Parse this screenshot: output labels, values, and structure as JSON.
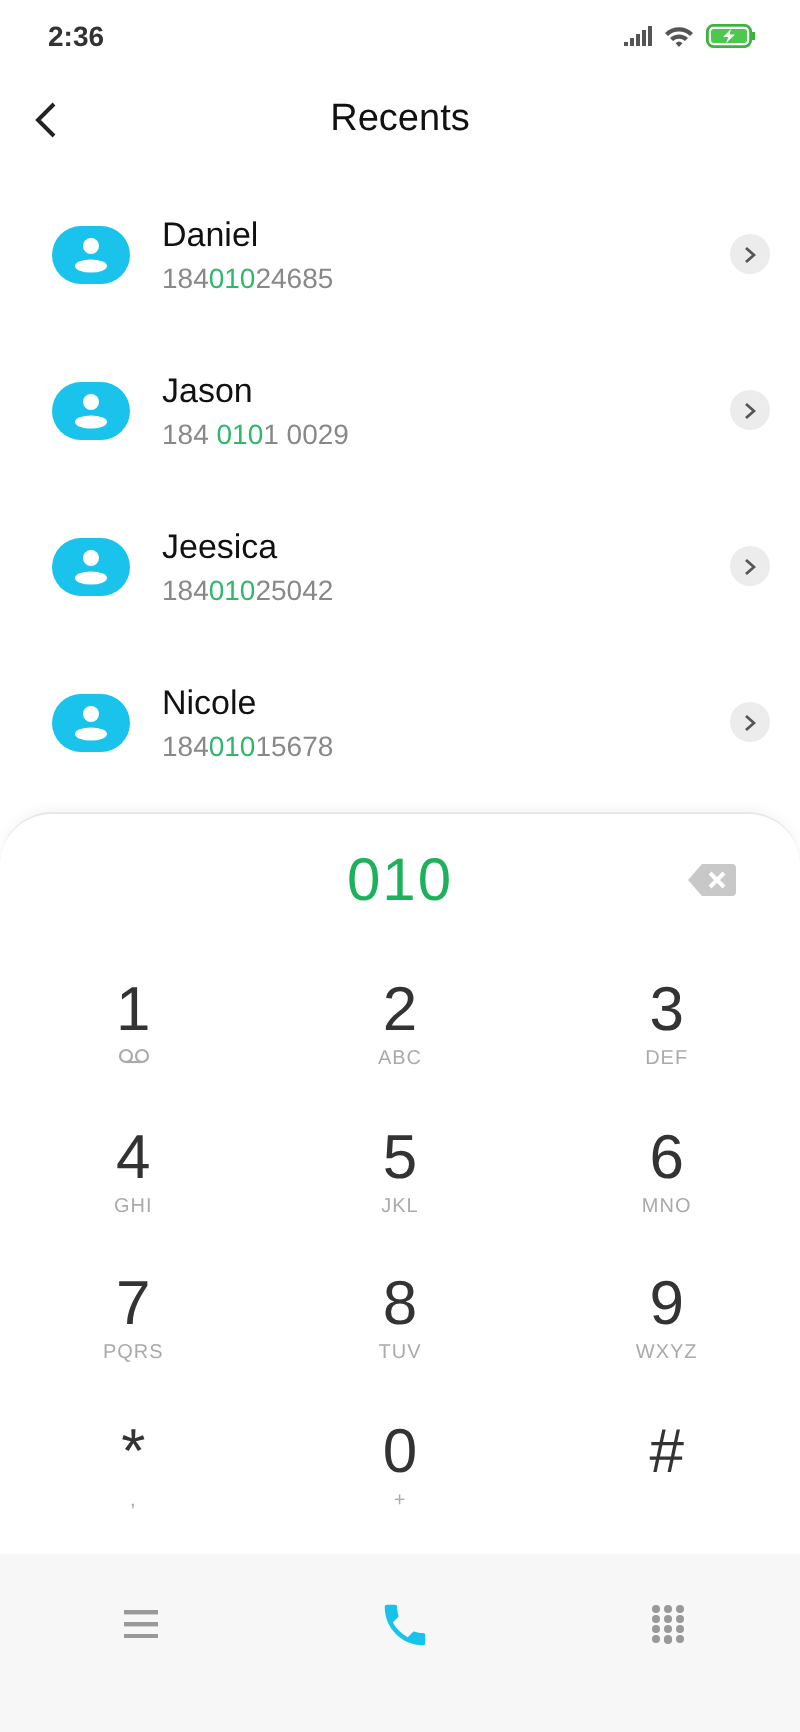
{
  "status_bar": {
    "time": "2:36"
  },
  "header": {
    "title": "Recents"
  },
  "recents": [
    {
      "name": "Daniel",
      "number": [
        {
          "text": "184",
          "match": false
        },
        {
          "text": "010",
          "match": true
        },
        {
          "text": "24685",
          "match": false
        }
      ]
    },
    {
      "name": "Jason",
      "number": [
        {
          "text": "184 ",
          "match": false
        },
        {
          "text": "010",
          "match": true
        },
        {
          "text": "1 0029",
          "match": false
        }
      ]
    },
    {
      "name": "Jeesica",
      "number": [
        {
          "text": "184",
          "match": false
        },
        {
          "text": "010",
          "match": true
        },
        {
          "text": "25042",
          "match": false
        }
      ]
    },
    {
      "name": "Nicole",
      "number": [
        {
          "text": "184",
          "match": false
        },
        {
          "text": "010",
          "match": true
        },
        {
          "text": "15678",
          "match": false
        }
      ]
    }
  ],
  "dialpad": {
    "input": "010",
    "keys": [
      {
        "digit": "1",
        "kind": "voicemail"
      },
      {
        "digit": "2",
        "kind": "letters",
        "letters": "ABC"
      },
      {
        "digit": "3",
        "kind": "letters",
        "letters": "DEF"
      },
      {
        "digit": "4",
        "kind": "letters",
        "letters": "GHI"
      },
      {
        "digit": "5",
        "kind": "letters",
        "letters": "JKL"
      },
      {
        "digit": "6",
        "kind": "letters",
        "letters": "MNO"
      },
      {
        "digit": "7",
        "kind": "letters",
        "letters": "PQRS"
      },
      {
        "digit": "8",
        "kind": "letters",
        "letters": "TUV"
      },
      {
        "digit": "9",
        "kind": "letters",
        "letters": "WXYZ"
      },
      {
        "digit": "*",
        "kind": "letters",
        "letters": ","
      },
      {
        "digit": "0",
        "kind": "letters",
        "letters": "+"
      },
      {
        "digit": "#",
        "kind": "plain"
      }
    ]
  }
}
